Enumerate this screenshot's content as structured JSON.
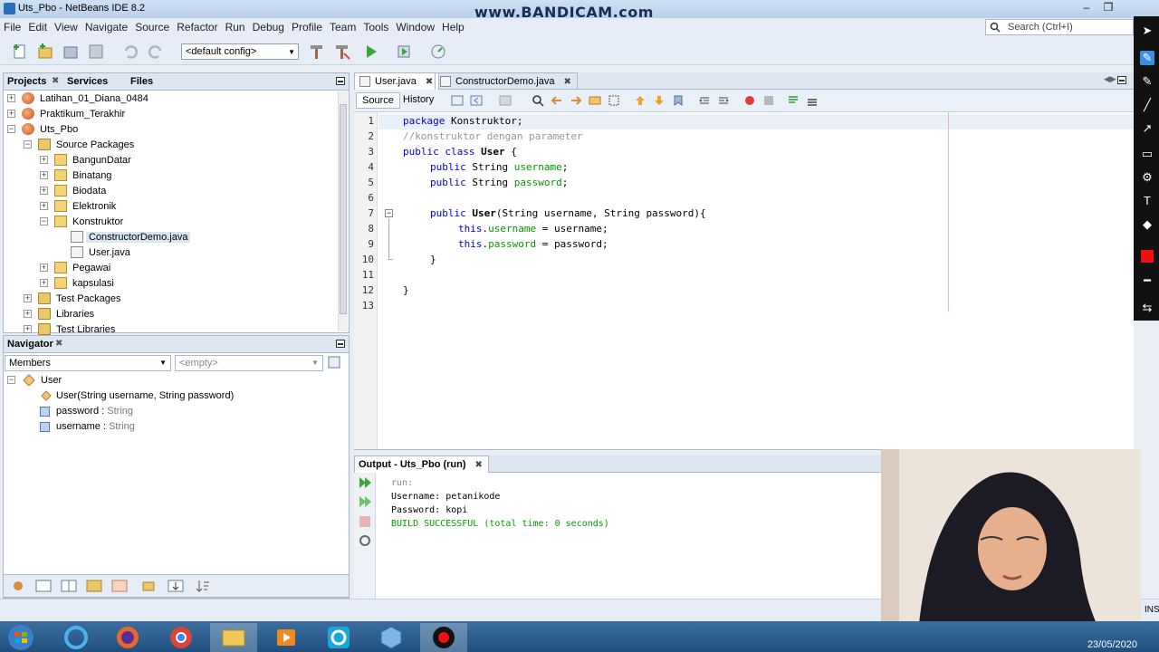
{
  "window": {
    "title": "Uts_Pbo - NetBeans IDE 8.2",
    "watermark": "www.BANDICAM.com"
  },
  "menu": [
    "File",
    "Edit",
    "View",
    "Navigate",
    "Source",
    "Refactor",
    "Run",
    "Debug",
    "Profile",
    "Team",
    "Tools",
    "Window",
    "Help"
  ],
  "search": {
    "placeholder": "Search (Ctrl+I)"
  },
  "toolbar": {
    "config": "<default config>"
  },
  "projects_panel": {
    "tabs": [
      "Projects",
      "Services",
      "Files"
    ],
    "tree": [
      {
        "label": "Latihan_01_Diana_0484",
        "level": 0,
        "kind": "project",
        "expander": "+"
      },
      {
        "label": "Praktikum_Terakhir",
        "level": 0,
        "kind": "project",
        "expander": "+"
      },
      {
        "label": "Uts_Pbo",
        "level": 0,
        "kind": "project",
        "expander": "−"
      },
      {
        "label": "Source Packages",
        "level": 1,
        "kind": "folder",
        "expander": "−"
      },
      {
        "label": "BangunDatar",
        "level": 2,
        "kind": "package",
        "expander": "+"
      },
      {
        "label": "Binatang",
        "level": 2,
        "kind": "package",
        "expander": "+"
      },
      {
        "label": "Biodata",
        "level": 2,
        "kind": "package",
        "expander": "+"
      },
      {
        "label": "Elektronik",
        "level": 2,
        "kind": "package",
        "expander": "+"
      },
      {
        "label": "Konstruktor",
        "level": 2,
        "kind": "package",
        "expander": "−"
      },
      {
        "label": "ConstructorDemo.java",
        "level": 3,
        "kind": "file",
        "expander": "",
        "selected": true
      },
      {
        "label": "User.java",
        "level": 3,
        "kind": "file",
        "expander": ""
      },
      {
        "label": "Pegawai",
        "level": 2,
        "kind": "package",
        "expander": "+"
      },
      {
        "label": "kapsulasi",
        "level": 2,
        "kind": "package",
        "expander": "+"
      },
      {
        "label": "Test Packages",
        "level": 1,
        "kind": "folder",
        "expander": "+"
      },
      {
        "label": "Libraries",
        "level": 1,
        "kind": "folder",
        "expander": "+"
      },
      {
        "label": "Test Libraries",
        "level": 1,
        "kind": "folder",
        "expander": "+"
      }
    ]
  },
  "navigator": {
    "title": "Navigator",
    "filter": "Members",
    "empty": "<empty>",
    "root": "User",
    "members": [
      {
        "name": "User(",
        "type": "String username, String password)",
        "kind": "constructor"
      },
      {
        "name": "password : ",
        "type": "String",
        "kind": "field"
      },
      {
        "name": "username : ",
        "type": "String",
        "kind": "field"
      }
    ]
  },
  "editor": {
    "tabs": [
      "User.java",
      "ConstructorDemo.java"
    ],
    "mode_tabs": [
      "Source",
      "History"
    ],
    "lines": [
      "1",
      "2",
      "3",
      "4",
      "5",
      "6",
      "7",
      "8",
      "9",
      "10",
      "11",
      "12",
      "13"
    ],
    "code": {
      "l1_kw": "package",
      "l1_rest": " Konstruktor;",
      "l2": "//konstruktor dengan parameter",
      "l3_kw": "public class",
      "l3_name": " User",
      "l3_rest": " {",
      "l4_kw": "public",
      "l4_type": " String ",
      "l4_field": "username",
      "l4_end": ";",
      "l5_kw": "public",
      "l5_type": " String ",
      "l5_field": "password",
      "l5_end": ";",
      "l7_kw": "public",
      "l7_name": " User",
      "l7_rest": "(String username, String password){",
      "l8_kw": "this",
      "l8_dot": ".",
      "l8_field": "username",
      "l8_rest": " = username;",
      "l9_kw": "this",
      "l9_dot": ".",
      "l9_field": "password",
      "l9_rest": " = password;",
      "l10": "}",
      "l12": "}"
    }
  },
  "output": {
    "title": "Output - Uts_Pbo (run)",
    "lines": [
      "run:",
      "Username: petanikode",
      "Password: kopi",
      "BUILD SUCCESSFUL (total time: 0 seconds)"
    ]
  },
  "status": {
    "ins": "INS",
    "date": "23/05/2020"
  },
  "colors": {
    "keyword": "#0000e6",
    "comment": "#969696",
    "field": "#009900",
    "success": "#00a000"
  }
}
